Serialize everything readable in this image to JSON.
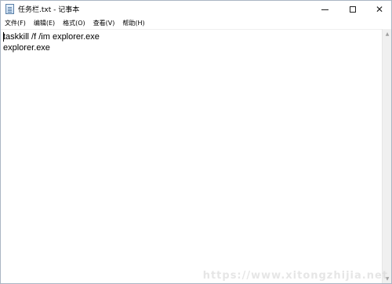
{
  "window": {
    "title": "任务栏.txt - 记事本",
    "icon": "notepad-icon"
  },
  "title_buttons": {
    "minimize_icon": "minimize-icon",
    "maximize_icon": "maximize-icon",
    "close_glyph": "✕"
  },
  "menu": {
    "items": [
      {
        "label": "文件(F)"
      },
      {
        "label": "编辑(E)"
      },
      {
        "label": "格式(O)"
      },
      {
        "label": "查看(V)"
      },
      {
        "label": "帮助(H)"
      }
    ]
  },
  "editor": {
    "lines": [
      "taskkill /f /im explorer.exe",
      "explorer.exe"
    ]
  },
  "scrollbar": {
    "up_glyph": "▲",
    "down_glyph": "▼"
  },
  "watermark": {
    "text": "https://www.xitongzhijia.net"
  }
}
